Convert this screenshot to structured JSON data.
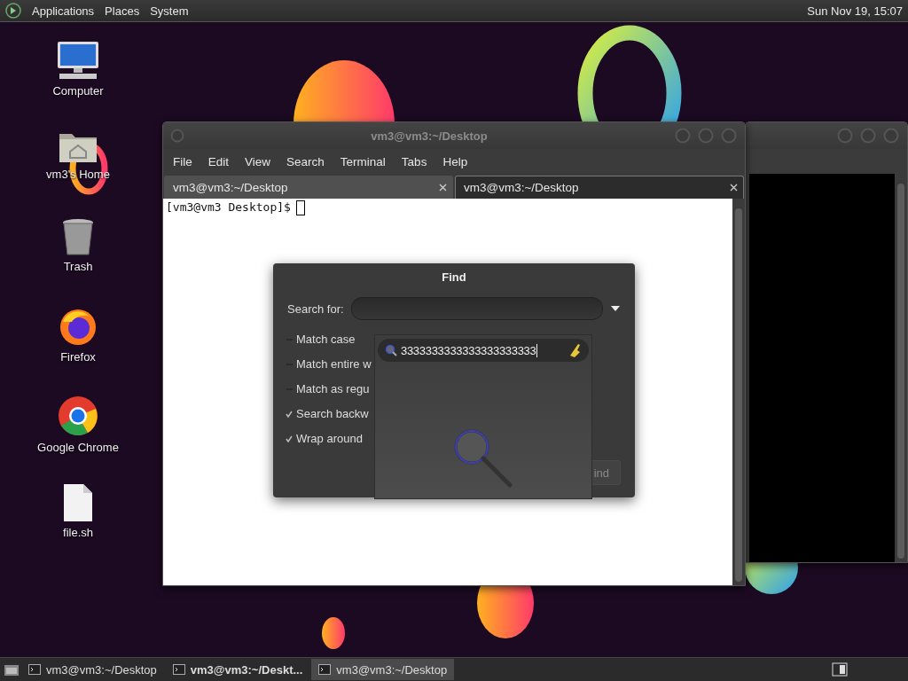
{
  "top_panel": {
    "menus": [
      "Applications",
      "Places",
      "System"
    ],
    "clock": "Sun Nov 19, 15:07"
  },
  "desktop_icons": [
    {
      "kind": "computer",
      "label": "Computer"
    },
    {
      "kind": "home",
      "label": "vm3's Home"
    },
    {
      "kind": "trash",
      "label": "Trash"
    },
    {
      "kind": "firefox",
      "label": "Firefox"
    },
    {
      "kind": "chrome",
      "label": "Google Chrome"
    },
    {
      "kind": "file",
      "label": "file.sh"
    }
  ],
  "terminal": {
    "title": "vm3@vm3:~/Desktop",
    "menu": [
      "File",
      "Edit",
      "View",
      "Search",
      "Terminal",
      "Tabs",
      "Help"
    ],
    "tabs": [
      {
        "label": "vm3@vm3:~/Desktop",
        "selected": false
      },
      {
        "label": "vm3@vm3:~/Desktop",
        "selected": true
      }
    ],
    "prompt": "[vm3@vm3 Desktop]$"
  },
  "find_dialog": {
    "title": "Find",
    "search_label": "Search for:",
    "options": [
      {
        "label": "Match case",
        "checked": false
      },
      {
        "label": "Match entire w",
        "checked": false
      },
      {
        "label": "Match as regu",
        "checked": false
      },
      {
        "label": "Search backw",
        "checked": true
      },
      {
        "label": "Wrap around",
        "checked": true
      }
    ],
    "find_button": "ind",
    "popup": {
      "value": "3333333333333333333333"
    }
  },
  "taskbar": {
    "items": [
      {
        "label": "vm3@vm3:~/Desktop",
        "active": false,
        "selected": false
      },
      {
        "label": "vm3@vm3:~/Deskt...",
        "active": true,
        "selected": false
      },
      {
        "label": "vm3@vm3:~/Desktop",
        "active": false,
        "selected": true
      }
    ]
  }
}
